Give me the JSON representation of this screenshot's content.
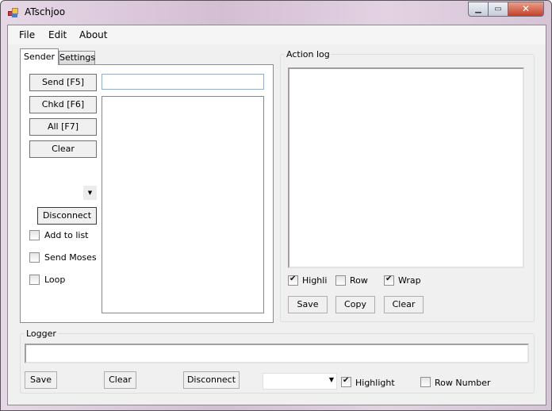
{
  "window": {
    "title": "ATschjoo",
    "controls": [
      "minimize",
      "maximize",
      "close"
    ]
  },
  "menu": [
    "File",
    "Edit",
    "About"
  ],
  "tabs": [
    "Sender",
    "Settings"
  ],
  "sender": {
    "buttons": [
      "Send [F5]",
      "Chkd [F6]",
      "All [F7]",
      "Clear"
    ],
    "input_value": "",
    "disconnect": "Disconnect",
    "checkboxes": [
      {
        "label": "Add to list",
        "checked": false
      },
      {
        "label": "Send Moses",
        "checked": false
      },
      {
        "label": "Loop",
        "checked": false
      }
    ]
  },
  "action_log": {
    "title": "Action log",
    "checkboxes": [
      {
        "label": "Highli",
        "checked": true
      },
      {
        "label": "Row",
        "checked": false
      },
      {
        "label": "Wrap",
        "checked": true
      }
    ],
    "buttons": [
      "Save",
      "Copy",
      "Clear"
    ]
  },
  "logger": {
    "title": "Logger",
    "input_value": "",
    "buttons": [
      "Save",
      "Clear",
      "Disconnect"
    ],
    "combo_value": "",
    "checkboxes": [
      {
        "label": "Highlight",
        "checked": true
      },
      {
        "label": "Row Number",
        "checked": false
      }
    ]
  }
}
